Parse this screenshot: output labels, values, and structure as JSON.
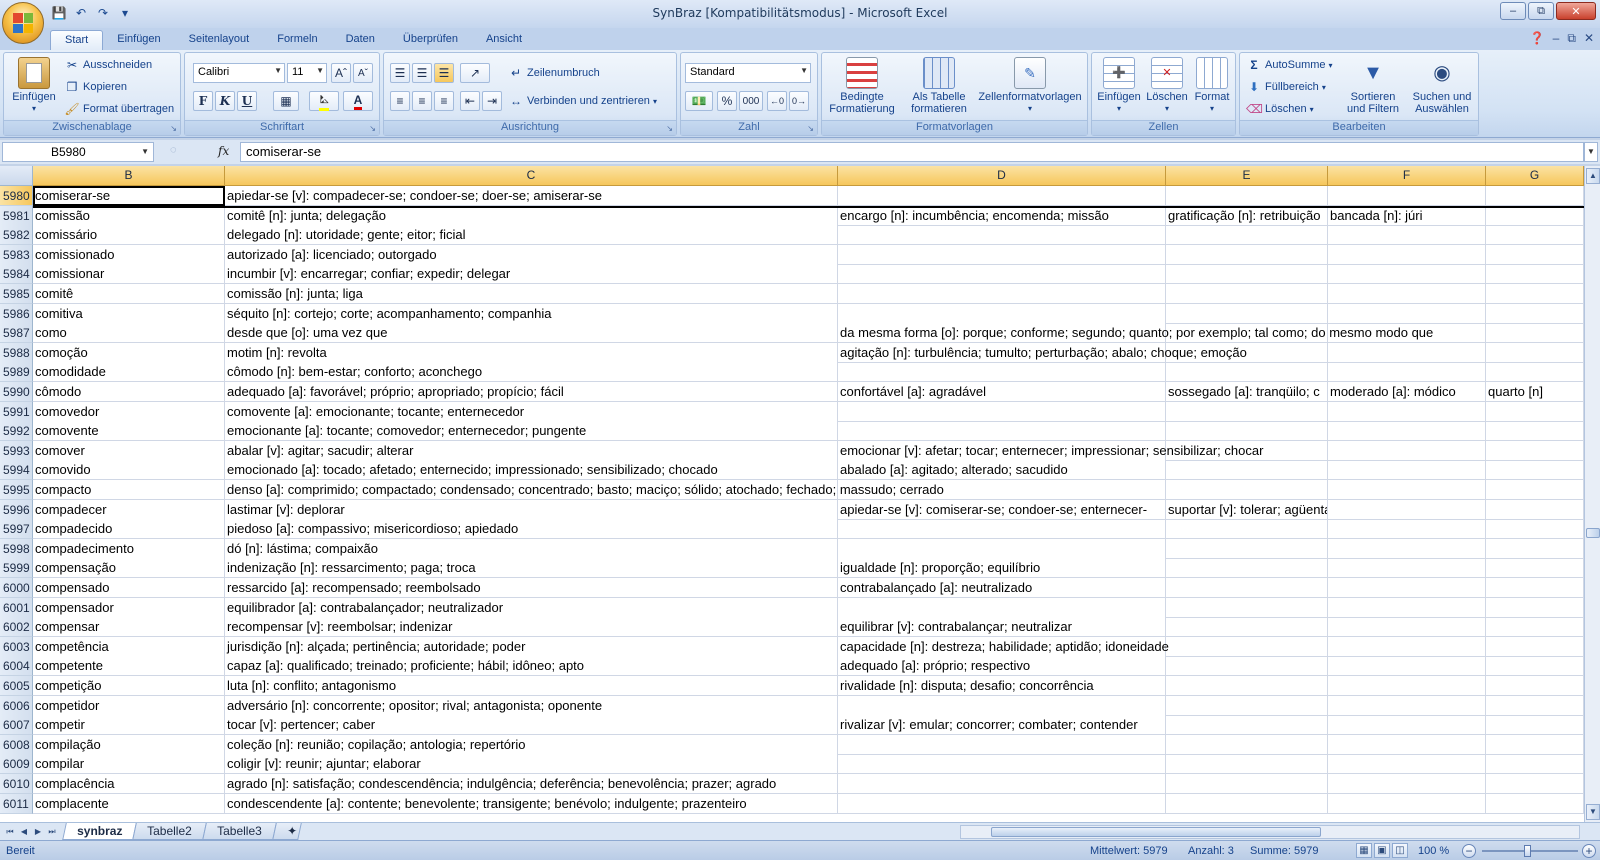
{
  "window": {
    "title": "SynBraz  [Kompatibilitätsmodus] - Microsoft Excel"
  },
  "tabs": [
    "Start",
    "Einfügen",
    "Seitenlayout",
    "Formeln",
    "Daten",
    "Überprüfen",
    "Ansicht"
  ],
  "ribbon": {
    "clipboard": {
      "label": "Zwischenablage",
      "paste": "Einfügen",
      "cut": "Ausschneiden",
      "copy": "Kopieren",
      "format_painter": "Format übertragen"
    },
    "font": {
      "label": "Schriftart",
      "font_name": "Calibri",
      "font_size": "11",
      "bold": "F",
      "italic": "K",
      "underline": "U"
    },
    "alignment": {
      "label": "Ausrichtung",
      "wrap": "Zeilenumbruch",
      "merge": "Verbinden und zentrieren"
    },
    "number": {
      "label": "Zahl",
      "format": "Standard",
      "percent": "%",
      "thousands": "000"
    },
    "styles": {
      "label": "Formatvorlagen",
      "conditional": [
        "Bedingte",
        "Formatierung"
      ],
      "as_table": [
        "Als Tabelle",
        "formatieren"
      ],
      "cell_styles": "Zellenformatvorlagen"
    },
    "cells": {
      "label": "Zellen",
      "insert": "Einfügen",
      "delete": "Löschen",
      "format": "Format"
    },
    "editing": {
      "label": "Bearbeiten",
      "autosum": "AutoSumme",
      "fill": "Füllbereich",
      "clear": "Löschen",
      "sort": [
        "Sortieren",
        "und Filtern"
      ],
      "find": [
        "Suchen und",
        "Auswählen"
      ]
    }
  },
  "formula_bar": {
    "name_box": "B5980",
    "fx": "fx",
    "value": "comiserar-se"
  },
  "columns": [
    "B",
    "C",
    "D",
    "E",
    "F",
    "G"
  ],
  "rows": [
    {
      "n": "5980",
      "B": "comiserar-se",
      "C": "apiedar-se [v]: compadecer-se; condoer-se; doer-se; amiserar-se",
      "D": "",
      "E": "",
      "F": "",
      "G": ""
    },
    {
      "n": "5981",
      "B": "comissão",
      "C": "comitê [n]: junta; delegação",
      "D": "encargo [n]: incumbência; encomenda; missão",
      "E": "gratificação [n]: retribuição",
      "F": "bancada [n]: júri",
      "G": ""
    },
    {
      "n": "5982",
      "B": "comissário",
      "C": "delegado [n]: utoridade; gente; eitor; ficial",
      "D": "",
      "E": "",
      "F": "",
      "G": ""
    },
    {
      "n": "5983",
      "B": "comissionado",
      "C": "autorizado [a]: licenciado; outorgado",
      "D": "",
      "E": "",
      "F": "",
      "G": ""
    },
    {
      "n": "5984",
      "B": "comissionar",
      "C": "incumbir [v]: encarregar; confiar; expedir; delegar",
      "D": "",
      "E": "",
      "F": "",
      "G": ""
    },
    {
      "n": "5985",
      "B": "comitê",
      "C": "comissão [n]: junta; liga",
      "D": "",
      "E": "",
      "F": "",
      "G": ""
    },
    {
      "n": "5986",
      "B": "comitiva",
      "C": "séquito [n]: cortejo; corte; acompanhamento; companhia",
      "D": "",
      "E": "",
      "F": "",
      "G": ""
    },
    {
      "n": "5987",
      "B": "como",
      "C": "desde que [o]: uma vez que",
      "D": "da mesma forma [o]: porque; conforme; segundo; quanto; por exemplo; tal como; do mesmo modo que",
      "E": "",
      "F": "",
      "G": ""
    },
    {
      "n": "5988",
      "B": "comoção",
      "C": "motim [n]: revolta",
      "D": "agitação [n]: turbulência; tumulto; perturbação; abalo; choque; emoção",
      "E": "",
      "F": "",
      "G": ""
    },
    {
      "n": "5989",
      "B": "comodidade",
      "C": "cômodo [n]: bem-estar; conforto; aconchego",
      "D": "",
      "E": "",
      "F": "",
      "G": ""
    },
    {
      "n": "5990",
      "B": "cômodo",
      "C": "adequado [a]: favorável; próprio; apropriado; propício; fácil",
      "D": "confortável [a]: agradável",
      "E": "sossegado [a]: tranqüilo; c",
      "F": "moderado [a]: módico",
      "G": "quarto [n]"
    },
    {
      "n": "5991",
      "B": "comovedor",
      "C": "comovente [a]: emocionante; tocante; enternecedor",
      "D": "",
      "E": "",
      "F": "",
      "G": ""
    },
    {
      "n": "5992",
      "B": "comovente",
      "C": "emocionante [a]: tocante; comovedor; enternecedor; pungente",
      "D": "",
      "E": "",
      "F": "",
      "G": ""
    },
    {
      "n": "5993",
      "B": "comover",
      "C": "abalar [v]: agitar; sacudir; alterar",
      "D": "emocionar [v]: afetar; tocar; enternecer; impressionar; sensibilizar; chocar",
      "E": "",
      "F": "",
      "G": ""
    },
    {
      "n": "5994",
      "B": "comovido",
      "C": "emocionado [a]: tocado; afetado; enternecido; impressionado; sensibilizado; chocado",
      "D": "abalado [a]: agitado; alterado; sacudido",
      "E": "",
      "F": "",
      "G": ""
    },
    {
      "n": "5995",
      "B": "compacto",
      "C": "denso [a]: comprimido; compactado; condensado; concentrado; basto; maciço; sólido; atochado; fechado; massudo; cerrado",
      "D": "",
      "E": "",
      "F": "",
      "G": ""
    },
    {
      "n": "5996",
      "B": "compadecer",
      "C": "lastimar [v]: deplorar",
      "D": "apiedar-se [v]: comiserar-se; condoer-se; enternecer-",
      "E": "suportar [v]: tolerar; agüentar; consentir; admitir",
      "F": "",
      "G": ""
    },
    {
      "n": "5997",
      "B": "compadecido",
      "C": "piedoso [a]: compassivo; misericordioso; apiedado",
      "D": "",
      "E": "",
      "F": "",
      "G": ""
    },
    {
      "n": "5998",
      "B": "compadecimento",
      "C": "dó [n]: lástima; compaixão",
      "D": "",
      "E": "",
      "F": "",
      "G": ""
    },
    {
      "n": "5999",
      "B": "compensação",
      "C": "indenização [n]: ressarcimento; paga; troca",
      "D": "igualdade [n]: proporção; equilíbrio",
      "E": "",
      "F": "",
      "G": ""
    },
    {
      "n": "6000",
      "B": "compensado",
      "C": "ressarcido [a]: recompensado; reembolsado",
      "D": "contrabalançado [a]: neutralizado",
      "E": "",
      "F": "",
      "G": ""
    },
    {
      "n": "6001",
      "B": "compensador",
      "C": "equilibrador [a]: contrabalançador; neutralizador",
      "D": "",
      "E": "",
      "F": "",
      "G": ""
    },
    {
      "n": "6002",
      "B": "compensar",
      "C": "recompensar [v]: reembolsar; indenizar",
      "D": "equilibrar [v]: contrabalançar; neutralizar",
      "E": "",
      "F": "",
      "G": ""
    },
    {
      "n": "6003",
      "B": "competência",
      "C": "jurisdição [n]: alçada; pertinência; autoridade; poder",
      "D": "capacidade [n]: destreza; habilidade; aptidão; idoneidade",
      "E": "",
      "F": "",
      "G": ""
    },
    {
      "n": "6004",
      "B": "competente",
      "C": "capaz [a]: qualificado; treinado; proficiente; hábil; idôneo; apto",
      "D": "adequado [a]: próprio; respectivo",
      "E": "",
      "F": "",
      "G": ""
    },
    {
      "n": "6005",
      "B": "competição",
      "C": "luta [n]: conflito; antagonismo",
      "D": "rivalidade [n]: disputa; desafio; concorrência",
      "E": "",
      "F": "",
      "G": ""
    },
    {
      "n": "6006",
      "B": "competidor",
      "C": "adversário [n]: concorrente; opositor; rival; antagonista; oponente",
      "D": "",
      "E": "",
      "F": "",
      "G": ""
    },
    {
      "n": "6007",
      "B": "competir",
      "C": "tocar [v]: pertencer; caber",
      "D": "rivalizar [v]: emular; concorrer; combater; contender",
      "E": "",
      "F": "",
      "G": ""
    },
    {
      "n": "6008",
      "B": "compilação",
      "C": "coleção [n]: reunião; copilação; antologia; repertório",
      "D": "",
      "E": "",
      "F": "",
      "G": ""
    },
    {
      "n": "6009",
      "B": "compilar",
      "C": "coligir [v]: reunir; ajuntar; elaborar",
      "D": "",
      "E": "",
      "F": "",
      "G": ""
    },
    {
      "n": "6010",
      "B": "complacência",
      "C": "agrado [n]: satisfação; condescendência; indulgência; deferência; benevolência; prazer; agrado",
      "D": "",
      "E": "",
      "F": "",
      "G": ""
    },
    {
      "n": "6011",
      "B": "complacente",
      "C": "condescendente [a]: contente; benevolente; transigente; benévolo; indulgente; prazenteiro",
      "D": "",
      "E": "",
      "F": "",
      "G": ""
    }
  ],
  "sheets": [
    "synbraz",
    "Tabelle2",
    "Tabelle3"
  ],
  "status": {
    "mode": "Bereit",
    "average": "Mittelwert: 5979",
    "count": "Anzahl: 3",
    "sum": "Summe: 5979",
    "zoom": "100 %"
  }
}
